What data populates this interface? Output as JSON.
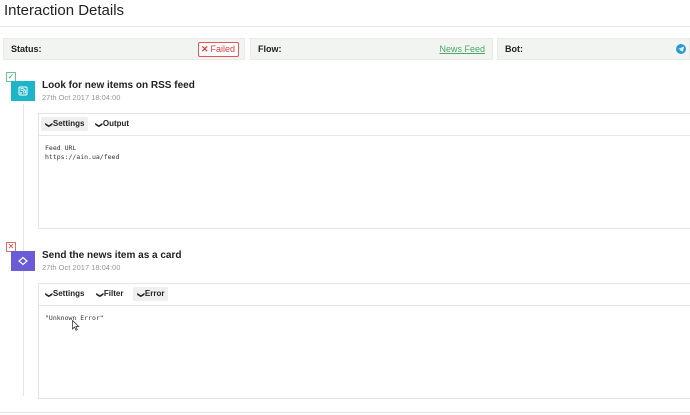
{
  "page": {
    "title": "Interaction Details"
  },
  "status_bar": {
    "status_label": "Status:",
    "status_value": "Failed",
    "flow_label": "Flow:",
    "flow_value": "News Feed",
    "bot_label": "Bot:",
    "bot_icon": "telegram-icon"
  },
  "steps": [
    {
      "state": "success",
      "title": "Look for new items on RSS feed",
      "date": "27th Oct 2017 18:04:00",
      "icon": "rss-icon",
      "tabs": [
        "Settings",
        "Output"
      ],
      "body_lines": [
        "Feed URL",
        "https://ain.ua/feed"
      ]
    },
    {
      "state": "error",
      "title": "Send the news item as a card",
      "date": "27th Oct 2017 18:04:00",
      "icon": "card-icon",
      "tabs": [
        "Settings",
        "Filter",
        "Error"
      ],
      "body_lines": [
        "\"Unknown Error\""
      ]
    }
  ],
  "colors": {
    "success": "#45a866",
    "error": "#d84040",
    "rss_bg": "#1db5c9",
    "card_bg": "#6b5bd6",
    "link": "#4aa86a"
  }
}
